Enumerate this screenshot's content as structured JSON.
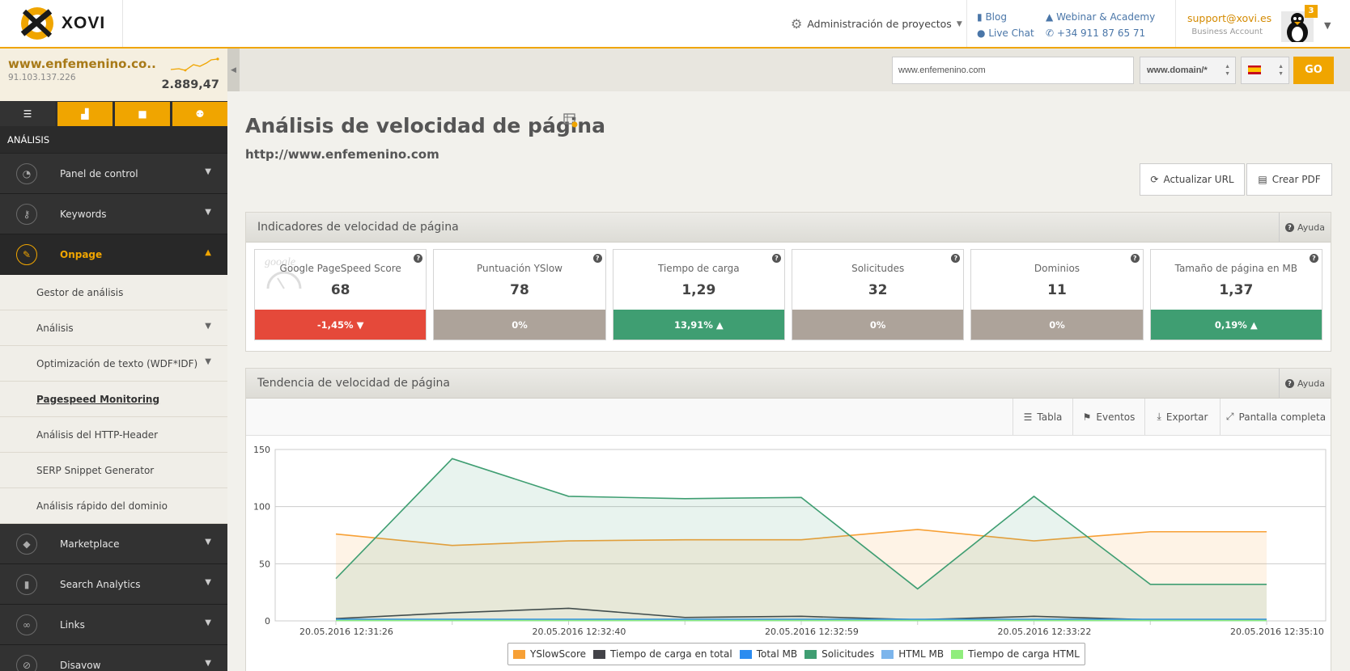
{
  "app": {
    "brand": "XOVI"
  },
  "header": {
    "projects_label": "Administración de proyectos",
    "links": [
      {
        "label": "Blog",
        "icon": "book-icon"
      },
      {
        "label": "Live Chat",
        "icon": "chat-icon"
      },
      {
        "label": "Webinar & Academy",
        "icon": "graduation-cap-icon"
      },
      {
        "label": "+34 911 87 65 71",
        "icon": "phone-icon"
      }
    ],
    "support_email": "support@xovi.es",
    "account_type": "Business Account",
    "notification_count": "3"
  },
  "sidebar": {
    "site_name": "www.enfemenino.co..",
    "site_ip": "91.103.137.226",
    "site_value": "2.889,47",
    "section_title": "ANÁLISIS",
    "tabs": [
      "list-icon",
      "chart-icon",
      "folder-icon",
      "users-icon"
    ],
    "menu": [
      {
        "label": "Panel de control",
        "icon": "dashboard-icon"
      },
      {
        "label": "Keywords",
        "icon": "key-icon"
      },
      {
        "label": "Onpage",
        "icon": "wrench-icon",
        "open": true
      }
    ],
    "submenu": [
      {
        "label": "Gestor de análisis"
      },
      {
        "label": "Análisis"
      },
      {
        "label": "Optimización de texto (WDF*IDF)"
      },
      {
        "label": "Pagespeed Monitoring"
      },
      {
        "label": "Análisis del HTTP-Header"
      },
      {
        "label": "SERP Snippet Generator"
      },
      {
        "label": "Análisis rápido del dominio"
      }
    ],
    "menu_after": [
      {
        "label": "Marketplace",
        "icon": "cube-icon"
      },
      {
        "label": "Search Analytics",
        "icon": "bar-chart-icon"
      },
      {
        "label": "Links",
        "icon": "link-icon"
      },
      {
        "label": "Disavow",
        "icon": "disavow-icon"
      }
    ]
  },
  "search": {
    "url_value": "www.enfemenino.com",
    "scope_value": "www.domain/*",
    "country_flag": "es-flag",
    "go_label": "GO"
  },
  "page": {
    "title": "Análisis de velocidad de página",
    "url": "http://www.enfemenino.com",
    "update_button": "Actualizar URL",
    "pdf_button": "Crear PDF"
  },
  "indicators": {
    "title": "Indicadores de velocidad de página",
    "help": "Ayuda",
    "watermark": "google",
    "cards": [
      {
        "label": "Google PageSpeed Score",
        "value": "68",
        "change": "-1,45% ▼",
        "status": "red"
      },
      {
        "label": "Puntuación YSlow",
        "value": "78",
        "change": "0%",
        "status": "grey"
      },
      {
        "label": "Tiempo de carga",
        "value": "1,29",
        "change": "13,91% ▲",
        "status": "green"
      },
      {
        "label": "Solicitudes",
        "value": "32",
        "change": "0%",
        "status": "grey"
      },
      {
        "label": "Dominios",
        "value": "11",
        "change": "0%",
        "status": "grey"
      },
      {
        "label": "Tamaño de página en MB",
        "value": "1,37",
        "change": "0,19% ▲",
        "status": "green"
      }
    ]
  },
  "trend": {
    "title": "Tendencia de velocidad de página",
    "help": "Ayuda",
    "toolbar": {
      "table": "Tabla",
      "events": "Eventos",
      "export": "Exportar",
      "fullscreen": "Pantalla completa"
    }
  },
  "chart_data": {
    "type": "area",
    "title": "",
    "xlabel": "",
    "ylabel": "",
    "ylim": [
      0,
      150
    ],
    "yticks": [
      0,
      50,
      100,
      150
    ],
    "x_tick_labels": [
      "20.05.2016 12:31:26",
      "20.05.2016 12:32:40",
      "20.05.2016 12:32:59",
      "20.05.2016 12:33:22",
      "20.05.2016 12:35:10"
    ],
    "point_count": 9,
    "grid": true,
    "legend": "bottom",
    "series": [
      {
        "name": "YSlowScore",
        "color": "#f7a035",
        "fill": true,
        "values": [
          76,
          66,
          70,
          71,
          71,
          80,
          70,
          78,
          78
        ]
      },
      {
        "name": "Tiempo de carga en total",
        "color": "#434348",
        "fill": false,
        "values": [
          2,
          7,
          11,
          3,
          4,
          1,
          4,
          1,
          1
        ]
      },
      {
        "name": "Total MB",
        "color": "#2b8cf0",
        "fill": false,
        "values": [
          1.4,
          1.4,
          1.4,
          1.4,
          1.4,
          1.4,
          1.4,
          1.4,
          1.4
        ]
      },
      {
        "name": "Solicitudes",
        "color": "#3f9e72",
        "fill": true,
        "values": [
          37,
          142,
          109,
          107,
          108,
          28,
          109,
          32,
          32
        ]
      },
      {
        "name": "HTML MB",
        "color": "#7cb5ec",
        "fill": false,
        "values": [
          0.2,
          0.2,
          0.2,
          0.2,
          0.2,
          0.2,
          0.2,
          0.2,
          0.2
        ]
      },
      {
        "name": "Tiempo de carga HTML",
        "color": "#90ed7d",
        "fill": false,
        "values": [
          0.3,
          0.3,
          0.3,
          0.3,
          0.3,
          0.3,
          0.3,
          0.3,
          0.3
        ]
      }
    ]
  }
}
